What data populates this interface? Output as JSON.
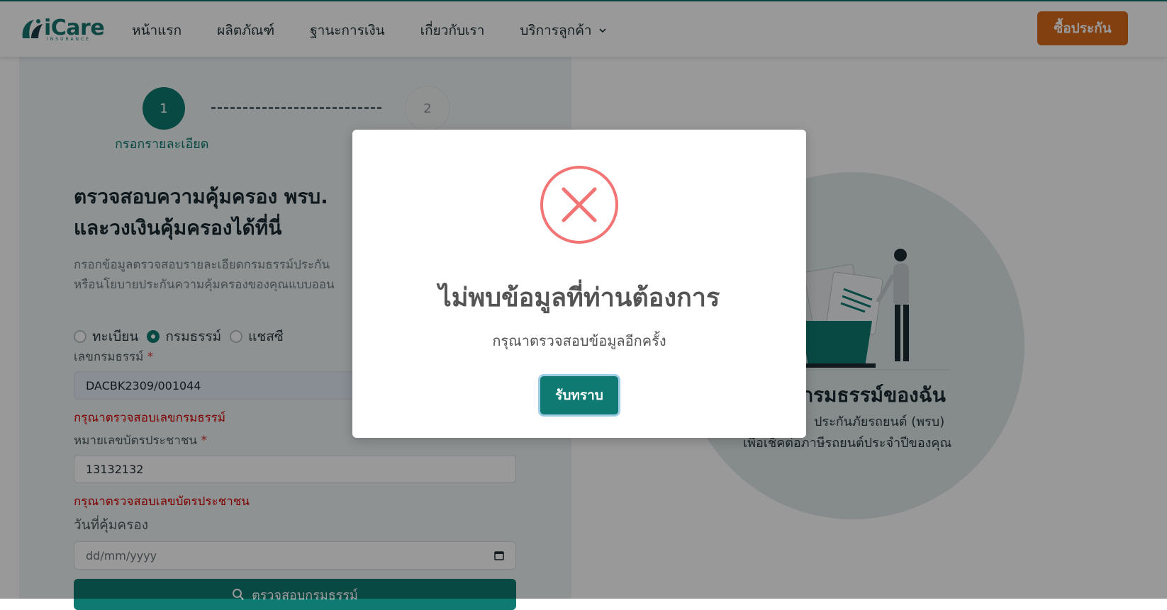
{
  "header": {
    "logo_text": "iCare",
    "logo_sub": "INSURANCE",
    "nav": [
      "หน้าแรก",
      "ผลิตภัณฑ์",
      "ฐานะการเงิน",
      "เกี่ยวกับเรา",
      "บริการลูกค้า"
    ],
    "buy_label": "ซื้อประกัน"
  },
  "steps": {
    "step1": "1",
    "step2": "2",
    "step1_label": "กรอกรายละเอียด"
  },
  "form": {
    "title_line1": "ตรวจสอบความคุ้มครอง พรบ.",
    "title_line2": "และวงเงินคุ้มครองได้ที่นี่",
    "desc_line1": "กรอกข้อมูลตรวจสอบรายละเอียดกรมธรรม์ประกัน",
    "desc_line2": "หรือนโยบายประกันความคุ้มครองของคุณแบบออน",
    "radios": [
      "ทะเบียน",
      "กรมธรรม์",
      "แชสซี"
    ],
    "selected_radio": "กรมธรรม์",
    "policy_label": "เลขกรมธรรม์",
    "required_mark": "*",
    "policy_value": "DACBK2309/001044",
    "policy_error": "กรุณาตรวจสอบเลขกรมธรรม์",
    "id_label": "หมายเลขบัตรประชาชน",
    "id_value": "13132132",
    "id_error": "กรุณาตรวจสอบเลขบัตรประชาชน",
    "date_label": "วันที่คุ้มครอง",
    "date_placeholder": "dd/mm/yyyy",
    "check_label": "ตรวจสอบกรมธรรม์"
  },
  "right": {
    "title": "กรมธรรม์ของฉัน",
    "sub1": "ประกันภัยรถยนต์ (พรบ)",
    "sub2": "เพื่อเช็คต่อภาษีรถยนต์ประจำปีของคุณ"
  },
  "modal": {
    "title": "ไม่พบข้อมูลที่ท่านต้องการ",
    "text": "กรุณาตรวจสอบข้อมูลอีกครั้ง",
    "ok_label": "รับทราบ"
  },
  "colors": {
    "accent": "#0f7a72",
    "buy_button": "#d9691a",
    "error": "#d40000",
    "error_icon": "#f27474"
  }
}
